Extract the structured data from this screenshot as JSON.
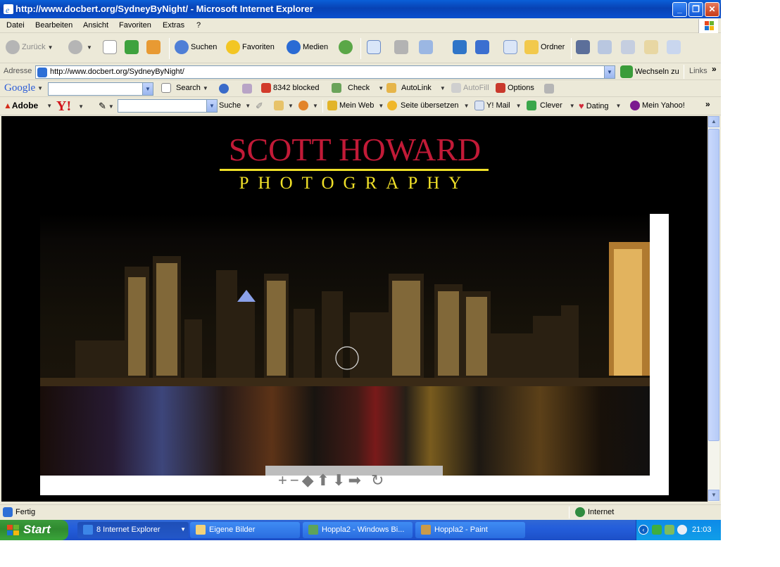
{
  "window": {
    "title": "http://www.docbert.org/SydneyByNight/ - Microsoft Internet Explorer",
    "minimize": "_",
    "maximize": "❐",
    "close": "✕"
  },
  "menu": [
    "Datei",
    "Bearbeiten",
    "Ansicht",
    "Favoriten",
    "Extras",
    "?"
  ],
  "toolbar": {
    "back": "Zurück",
    "search": "Suchen",
    "favorites": "Favoriten",
    "media": "Medien",
    "folders": "Ordner"
  },
  "address": {
    "label": "Adresse",
    "url": "http://www.docbert.org/SydneyByNight/",
    "go": "Wechseln zu",
    "links": "Links"
  },
  "google_bar": {
    "brand": "Google",
    "search": "Search",
    "blocked": "8342 blocked",
    "check": "Check",
    "autolink": "AutoLink",
    "autofill": "AutoFill",
    "options": "Options"
  },
  "yahoo_bar": {
    "adobe": "Adobe",
    "yahoo": "Y!",
    "search": "Suche",
    "my_web": "Mein Web",
    "translate": "Seite übersetzen",
    "mail": "Y! Mail",
    "clever": "Clever",
    "dating": "Dating",
    "my_yahoo": "Mein Yahoo!"
  },
  "page": {
    "logo_main": "SCOTT HOWARD",
    "logo_sub": "PHOTOGRAPHY",
    "zoom_controls": "+−◆⬆⬇➡ ↻"
  },
  "status": {
    "text": "Fertig",
    "zone": "Internet"
  },
  "taskbar": {
    "start": "Start",
    "tasks": [
      {
        "label": "8 Internet Explorer"
      },
      {
        "label": "Eigene Bilder"
      },
      {
        "label": "Hoppla2 - Windows Bi..."
      },
      {
        "label": "Hoppla2 - Paint"
      }
    ],
    "clock": "21:03"
  },
  "colors": {
    "title_blue": "#0842b4",
    "logo_red": "#c21a37",
    "logo_yellow": "#f0e028"
  }
}
